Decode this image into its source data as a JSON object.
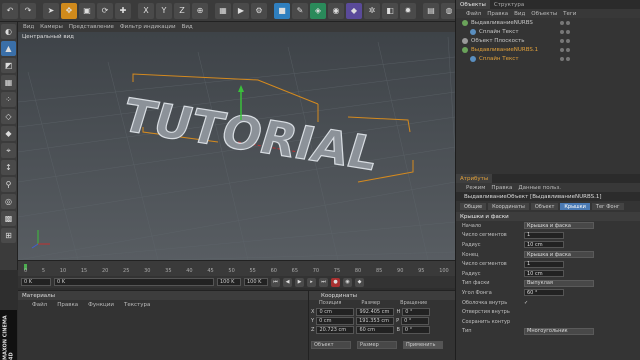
{
  "viewport": {
    "menu": [
      "Вид",
      "Камеры",
      "Представление",
      "Фильтр индикации",
      "Вид"
    ],
    "label": "Центральный вид",
    "text3d": "TUTORIAL"
  },
  "timeline": {
    "ticks": [
      "0",
      "5",
      "10",
      "15",
      "20",
      "25",
      "30",
      "35",
      "40",
      "45",
      "50",
      "55",
      "60",
      "65",
      "70",
      "75",
      "80",
      "85",
      "90",
      "95",
      "100"
    ],
    "frame_field": "0 K",
    "start": "0 K",
    "end": "100 K",
    "end2": "100 K"
  },
  "materials": {
    "title": "Материалы",
    "menu": [
      "Файл",
      "Правка",
      "Функции",
      "Текстура"
    ]
  },
  "coords": {
    "title": "Координаты",
    "cols": [
      "Позиция",
      "Размер",
      "Вращение"
    ],
    "rows": [
      {
        "axis": "X",
        "pos": "0 cm",
        "size": "992.405 cm",
        "rot_axis": "H",
        "rot": "0 °"
      },
      {
        "axis": "Y",
        "pos": "0 cm",
        "size": "191.353 cm",
        "rot_axis": "P",
        "rot": "0 °"
      },
      {
        "axis": "Z",
        "pos": "20.723 cm",
        "size": "60 cm",
        "rot_axis": "B",
        "rot": "0 °"
      }
    ],
    "mode1": "Объект",
    "mode2": "Размер",
    "apply": "Применить"
  },
  "objects": {
    "tabs": [
      "Объекты",
      "Структура"
    ],
    "menu": [
      "Файл",
      "Правка",
      "Вид",
      "Объекты",
      "Теги"
    ],
    "items": [
      {
        "name": "ВыдавливаниеNURBS",
        "indent": 0
      },
      {
        "name": "Сплайн Текст",
        "indent": 1
      },
      {
        "name": "Объект Плоскость",
        "indent": 0
      },
      {
        "name": "ВыдавливаниеNURBS.1",
        "indent": 0
      },
      {
        "name": "Сплайн Текст",
        "indent": 1
      }
    ]
  },
  "attributes": {
    "tab": "Атрибуты",
    "menu": [
      "Режим",
      "Правка",
      "Данные польз."
    ],
    "title": "ВыдавливаниеОбъект [ВыдавливаниеNURBS.1]",
    "tabs": [
      "Общие",
      "Координаты",
      "Объект",
      "Крышки",
      "Тег Фонг"
    ],
    "section": "Крышки и фаски",
    "rows": [
      {
        "label": "Начало",
        "value": "Крышка и фаска",
        "kind": "drop"
      },
      {
        "label": "Число сегментов",
        "value": "1",
        "kind": "val"
      },
      {
        "label": "Радиус",
        "value": "10 cm",
        "kind": "val"
      },
      {
        "label": "Конец",
        "value": "Крышка и фаска",
        "kind": "drop"
      },
      {
        "label": "Число сегментов",
        "value": "1",
        "kind": "val"
      },
      {
        "label": "Радиус",
        "value": "10 cm",
        "kind": "val"
      },
      {
        "label": "Тип фаски",
        "value": "Выпуклая",
        "kind": "drop"
      },
      {
        "label": "Угол Фонга",
        "value": "60 °",
        "kind": "val"
      },
      {
        "label": "Оболочка внутрь",
        "value": "✓",
        "kind": "chk"
      },
      {
        "label": "Отверстия внутрь",
        "value": "",
        "kind": "chk"
      },
      {
        "label": "Сохранить контур",
        "value": "",
        "kind": "chk"
      },
      {
        "label": "Тип",
        "value": "Многоугольник",
        "kind": "drop"
      }
    ]
  },
  "logo": "MAXON CINEMA 4D"
}
